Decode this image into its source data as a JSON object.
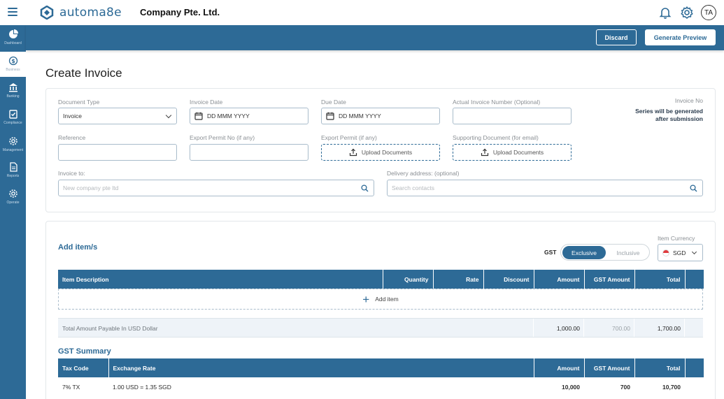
{
  "header": {
    "brand": "automa8e",
    "company": "Company Pte. Ltd.",
    "avatar_initials": "TA",
    "icons": [
      "menu-icon",
      "bell-icon",
      "gear-icon"
    ]
  },
  "actions": {
    "discard": "Discard",
    "generate_preview": "Generate Preview"
  },
  "sidebar": {
    "items": [
      {
        "label": "Dashboard",
        "icon": "pie-chart-icon"
      },
      {
        "label": "Business",
        "icon": "dollar-cycle-icon",
        "active": true
      },
      {
        "label": "Banking",
        "icon": "bank-icon"
      },
      {
        "label": "Compliance",
        "icon": "clipboard-check-icon"
      },
      {
        "label": "Management",
        "icon": "gear-icon"
      },
      {
        "label": "Reports",
        "icon": "document-icon"
      },
      {
        "label": "Operate",
        "icon": "gear-icon"
      }
    ]
  },
  "page": {
    "title": "Create Invoice"
  },
  "form": {
    "document_type": {
      "label": "Document Type",
      "value": "Invoice"
    },
    "invoice_date": {
      "label": "Invoice Date",
      "placeholder": "DD MMM YYYY"
    },
    "due_date": {
      "label": "Due Date",
      "placeholder": "DD MMM YYYY"
    },
    "actual_invoice_number": {
      "label": "Actual Invoice Number (Optional)",
      "value": ""
    },
    "invoice_no": {
      "label": "Invoice No",
      "note_line1": "Series will be generated",
      "note_line2": "after submission"
    },
    "reference": {
      "label": "Reference",
      "value": ""
    },
    "export_permit_no": {
      "label": "Export Permit No (if any)",
      "value": ""
    },
    "export_permit": {
      "label": "Export Permit (if any)",
      "button": "Upload Documents"
    },
    "supporting_document": {
      "label": "Supporting Document (for email)",
      "button": "Upload Documents"
    },
    "invoice_to": {
      "label": "Invoice to:",
      "placeholder": "New company pte ltd"
    },
    "delivery_address": {
      "label": "Delivery address: (optional)",
      "placeholder": "Search contacts"
    }
  },
  "items_section": {
    "title": "Add item/s",
    "gst_label": "GST",
    "gst_options": [
      "Exclusive",
      "Inclusive"
    ],
    "gst_selected": "Exclusive",
    "currency_label": "Item Currency",
    "currency": "SGD",
    "columns": [
      "Item Description",
      "Quantity",
      "Rate",
      "Discount",
      "Amount",
      "GST Amount",
      "Total"
    ],
    "add_item": "Add item",
    "total_row": {
      "label": "Total Amount Payable In USD Dollar",
      "amount": "1,000.00",
      "gst_amount": "700.00",
      "total": "1,700.00"
    }
  },
  "gst_summary": {
    "title": "GST Summary",
    "columns": [
      "Tax Code",
      "Exchange Rate",
      "Amount",
      "GST Amount",
      "Total"
    ],
    "rows": [
      {
        "tax_code": "7% TX",
        "exchange_rate": "1.00 USD = 1.35 SGD",
        "amount": "10,000",
        "gst_amount": "700",
        "total": "10,700"
      }
    ]
  }
}
